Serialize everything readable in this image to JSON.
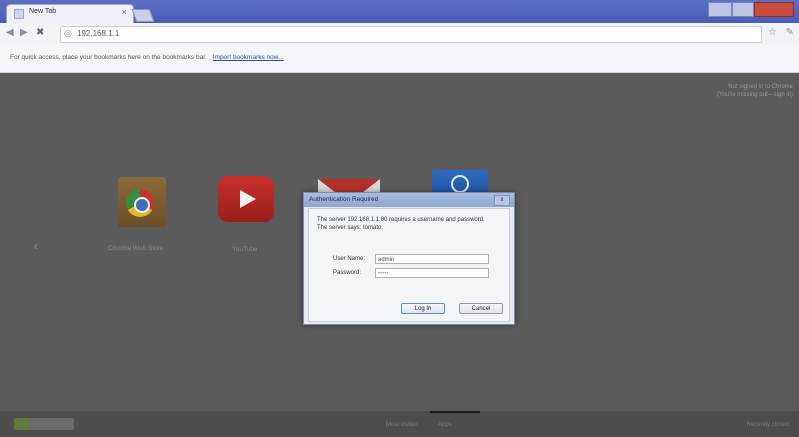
{
  "browser": {
    "tab_title": "New Tab",
    "tab_close": "×",
    "url": "192.168.1.1",
    "bookmark_bar": {
      "message": "For quick access, place your bookmarks here on the bookmarks bar.",
      "link": "Import bookmarks now..."
    },
    "icons": {
      "back": "◀",
      "forward": "▶",
      "stop": "✖",
      "globe": "◎",
      "star": "☆",
      "wrench": "✎"
    }
  },
  "page": {
    "sign_in_line1": "Not signed in to Chrome",
    "sign_in_line2": "(You're missing out—sign in)",
    "apps": [
      {
        "label": "Chrome Web Store"
      },
      {
        "label": "YouTube"
      }
    ],
    "prev_arrow": "‹",
    "footer": {
      "most_visited": "Most visited",
      "apps": "Apps",
      "recently_closed": "Recently closed"
    }
  },
  "dialog": {
    "title": "Authentication Required",
    "close": "x",
    "message_line1": "The server 192.168.1.1:80 requires a username and password.",
    "message_line2": "The server says: tomato.",
    "username_label": "User Name:",
    "username_value": "admin",
    "password_label": "Password:",
    "password_value": "•••••",
    "login_button": "Log In",
    "cancel_button": "Cancel"
  },
  "colors": {
    "titlebar": "#4a5cb5",
    "page_background": "#5b5b5b",
    "dialog_frame": "#e6ebf2"
  }
}
